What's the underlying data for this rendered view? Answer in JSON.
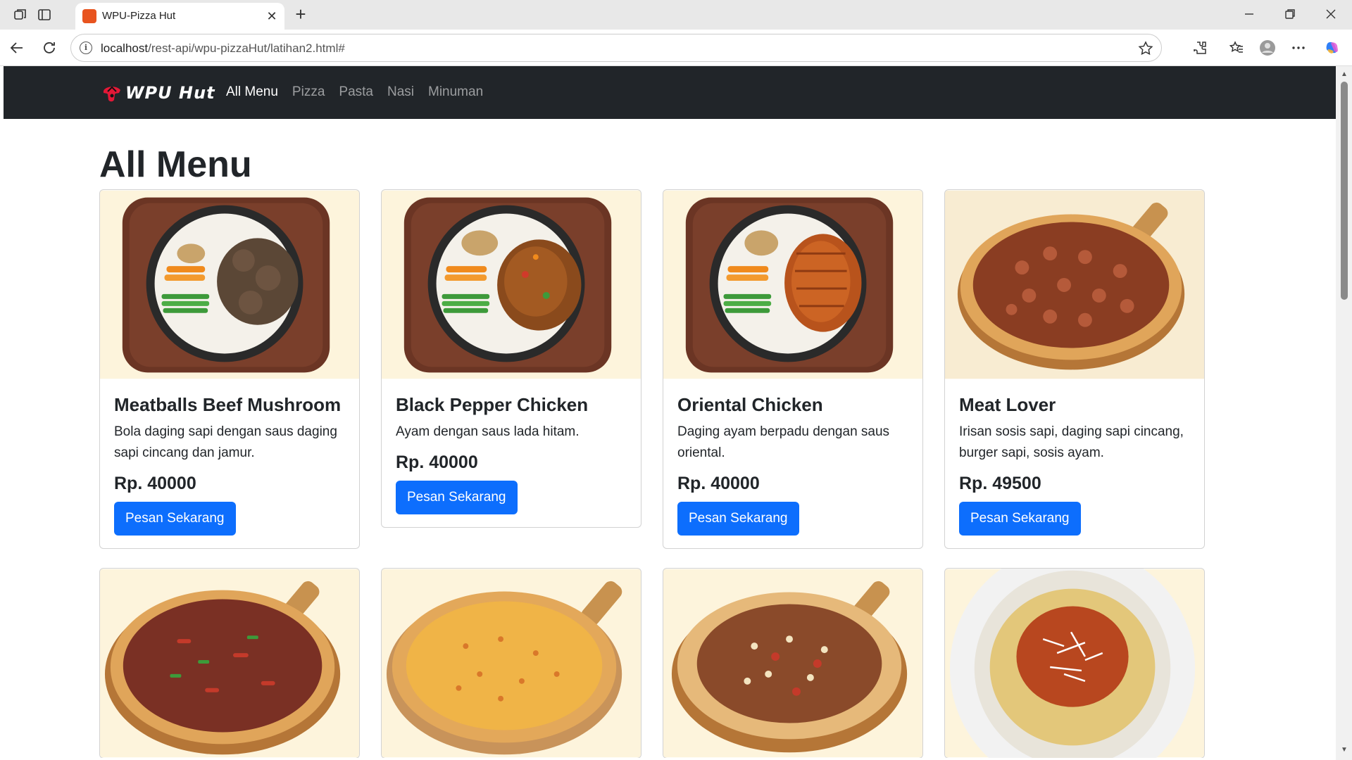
{
  "browser": {
    "tab_title": "WPU-Pizza Hut",
    "url_host": "localhost",
    "url_path": "/rest-api/wpu-pizzaHut/latihan2.html#"
  },
  "navbar": {
    "brand": "WPU Hut",
    "links": [
      {
        "label": "All Menu",
        "active": true
      },
      {
        "label": "Pizza",
        "active": false
      },
      {
        "label": "Pasta",
        "active": false
      },
      {
        "label": "Nasi",
        "active": false
      },
      {
        "label": "Minuman",
        "active": false
      }
    ]
  },
  "page": {
    "title": "All Menu",
    "button_label": "Pesan Sekarang"
  },
  "menu": [
    {
      "name": "Meatballs Beef Mushroom",
      "description": "Bola daging sapi dengan saus daging sapi cincang dan jamur.",
      "price": "Rp. 40000",
      "image": "rice-bowl-meatballs"
    },
    {
      "name": "Black Pepper Chicken",
      "description": "Ayam dengan saus lada hitam.",
      "price": "Rp. 40000",
      "image": "rice-bowl-black-pepper"
    },
    {
      "name": "Oriental Chicken",
      "description": "Daging ayam berpadu dengan saus oriental.",
      "price": "Rp. 40000",
      "image": "rice-bowl-oriental"
    },
    {
      "name": "Meat Lover",
      "description": "Irisan sosis sapi, daging sapi cincang, burger sapi, sosis ayam.",
      "price": "Rp. 49500",
      "image": "pizza-meat-lover"
    },
    {
      "image": "pizza-beef"
    },
    {
      "image": "pizza-cheese"
    },
    {
      "image": "pizza-stuffed-crust"
    },
    {
      "image": "spaghetti"
    }
  ],
  "colors": {
    "navbar_bg": "#212529",
    "primary": "#0d6efd",
    "card_image_bg": "#fdf4dc"
  }
}
